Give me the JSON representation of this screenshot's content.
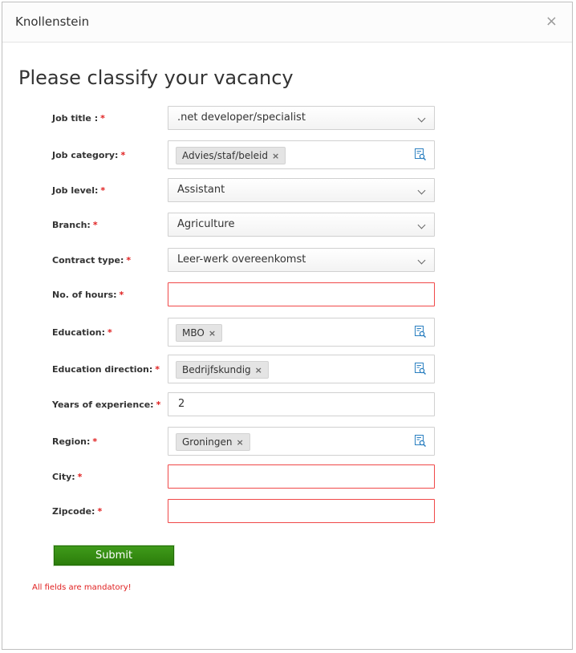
{
  "dialog": {
    "title": "Knollenstein",
    "close": "×"
  },
  "heading": "Please classify your vacancy",
  "fields": {
    "job_title": {
      "label": "Job title :",
      "value": ".net developer/specialist"
    },
    "job_category": {
      "label": "Job category:",
      "tag": "Advies/staf/beleid"
    },
    "job_level": {
      "label": "Job level:",
      "value": "Assistant"
    },
    "branch": {
      "label": "Branch:",
      "value": "Agriculture"
    },
    "contract_type": {
      "label": "Contract type:",
      "value": "Leer-werk overeenkomst"
    },
    "hours": {
      "label": "No. of hours:",
      "value": ""
    },
    "education": {
      "label": "Education:",
      "tag": "MBO"
    },
    "education_direction": {
      "label": "Education direction:",
      "tag": "Bedrijfskundig"
    },
    "experience": {
      "label": "Years of experience:",
      "value": "2"
    },
    "region": {
      "label": "Region:",
      "tag": "Groningen"
    },
    "city": {
      "label": "City:",
      "value": ""
    },
    "zipcode": {
      "label": "Zipcode:",
      "value": ""
    }
  },
  "required_mark": "*",
  "tag_remove": "×",
  "submit_label": "Submit",
  "note": "All fields are mandatory!",
  "colors": {
    "required": "#e02020",
    "error_border": "#f04848",
    "submit": "#3f9b1a",
    "lookup_icon": "#2a7fc0"
  },
  "icons": {
    "close": "close-icon",
    "dropdown": "chevron-down-icon",
    "lookup": "lookup-list-icon",
    "remove": "remove-tag-icon"
  }
}
